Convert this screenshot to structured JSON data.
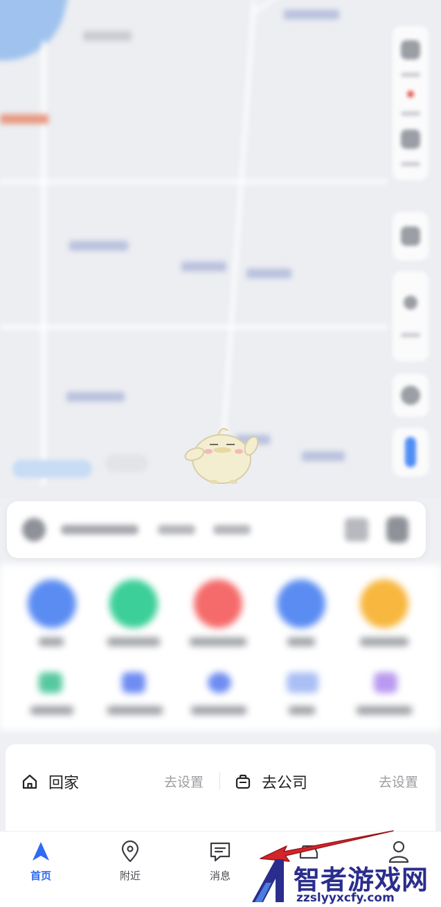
{
  "shortcuts": {
    "home": {
      "label": "回家",
      "action": "去设置"
    },
    "company": {
      "label": "去公司",
      "action": "去设置"
    }
  },
  "tabbar": {
    "items": [
      {
        "label": "首页",
        "icon": "navigation-arrow-icon",
        "active": true
      },
      {
        "label": "附近",
        "icon": "location-pin-icon",
        "active": false
      },
      {
        "label": "消息",
        "icon": "message-icon",
        "active": false
      },
      {
        "label": "",
        "icon": "taxi-icon",
        "active": false
      },
      {
        "label": "",
        "icon": "user-icon",
        "active": false
      }
    ]
  },
  "watermark": {
    "title": "智者游戏网",
    "url": "zzslyyxcfy.com"
  },
  "colors": {
    "accent": "#2f6bf3",
    "annotation_arrow": "#d2262b",
    "watermark": "#2a2d8c"
  }
}
